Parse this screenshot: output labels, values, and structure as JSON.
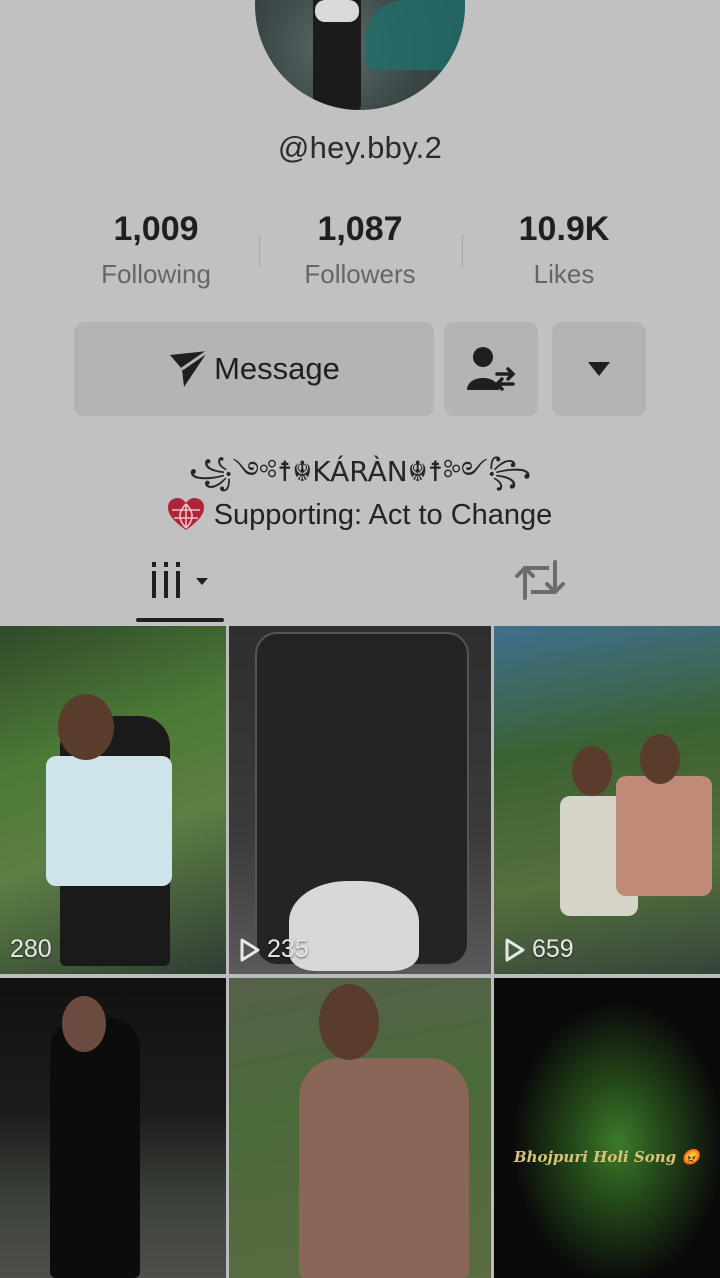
{
  "profile": {
    "username": "@hey.bby.2",
    "bio": "꧁༺☨☬KÁRÀN☬☨༻꧂",
    "supporting": "Supporting: Act to Change"
  },
  "stats": {
    "following": {
      "value": "1,009",
      "label": "Following"
    },
    "followers": {
      "value": "1,087",
      "label": "Followers"
    },
    "likes": {
      "value": "10.9K",
      "label": "Likes"
    }
  },
  "actions": {
    "message_label": "Message"
  },
  "icons": {
    "message": "paper-plane-icon",
    "friends": "user-swap-icon",
    "more": "caret-down-icon",
    "videos_tab": "grid-lines-icon",
    "repost_tab": "repost-icon",
    "supporting": "heart-globe-icon",
    "play": "play-icon"
  },
  "videos": [
    {
      "views": "280",
      "show_play": false
    },
    {
      "views": "235",
      "show_play": true
    },
    {
      "views": "659",
      "show_play": true
    },
    {
      "views": "",
      "show_play": false
    },
    {
      "views": "",
      "show_play": false
    },
    {
      "views": "",
      "show_play": false,
      "caption": "Bhojpuri Holi Song 😡"
    }
  ],
  "colors": {
    "overlay": "#c1c1c1",
    "accent_heart": "#b0243a"
  }
}
